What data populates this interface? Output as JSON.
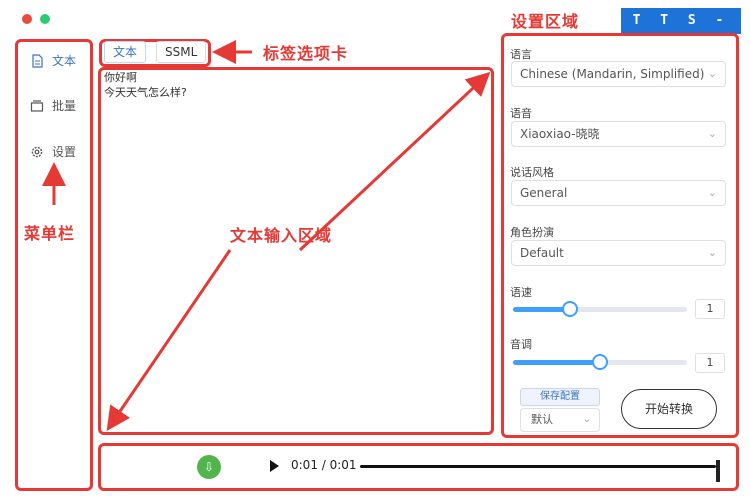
{
  "window": {
    "close_color": "#e74c3c",
    "max_color": "#2ecc71"
  },
  "brand": {
    "text": "T T S - V U E",
    "bg_color": "#1e73d8"
  },
  "annotations": {
    "tab_bar": "标签选项卡",
    "settings_area": "设置区域",
    "menu_bar": "菜单栏",
    "text_input_area": "文本输入区域",
    "color": "#e53935"
  },
  "sidebar": {
    "items": [
      {
        "label": "文本",
        "icon": "document-icon",
        "active": true
      },
      {
        "label": "批量",
        "icon": "folder-icon",
        "active": false
      },
      {
        "label": "设置",
        "icon": "gear-icon",
        "active": false
      }
    ]
  },
  "tabs": [
    {
      "label": "文本",
      "active": true
    },
    {
      "label": "SSML",
      "active": false
    }
  ],
  "text_input": {
    "value": "你好啊\n今天天气怎么样?"
  },
  "settings": {
    "language": {
      "label": "语言",
      "value": "Chinese (Mandarin, Simplified)"
    },
    "voice": {
      "label": "语音",
      "value": "Xiaoxiao-晓晓"
    },
    "style": {
      "label": "说话风格",
      "value": "General"
    },
    "role": {
      "label": "角色扮演",
      "value": "Default"
    },
    "rate": {
      "label": "语速",
      "value": "1",
      "fraction": 0.33
    },
    "pitch": {
      "label": "音调",
      "value": "1",
      "fraction": 0.5
    },
    "save_config": "保存配置",
    "config_select": "默认",
    "start": "开始转换",
    "accent_color": "#409eff"
  },
  "player": {
    "time": "0:01 / 0:01",
    "download_color": "#52b54b"
  }
}
